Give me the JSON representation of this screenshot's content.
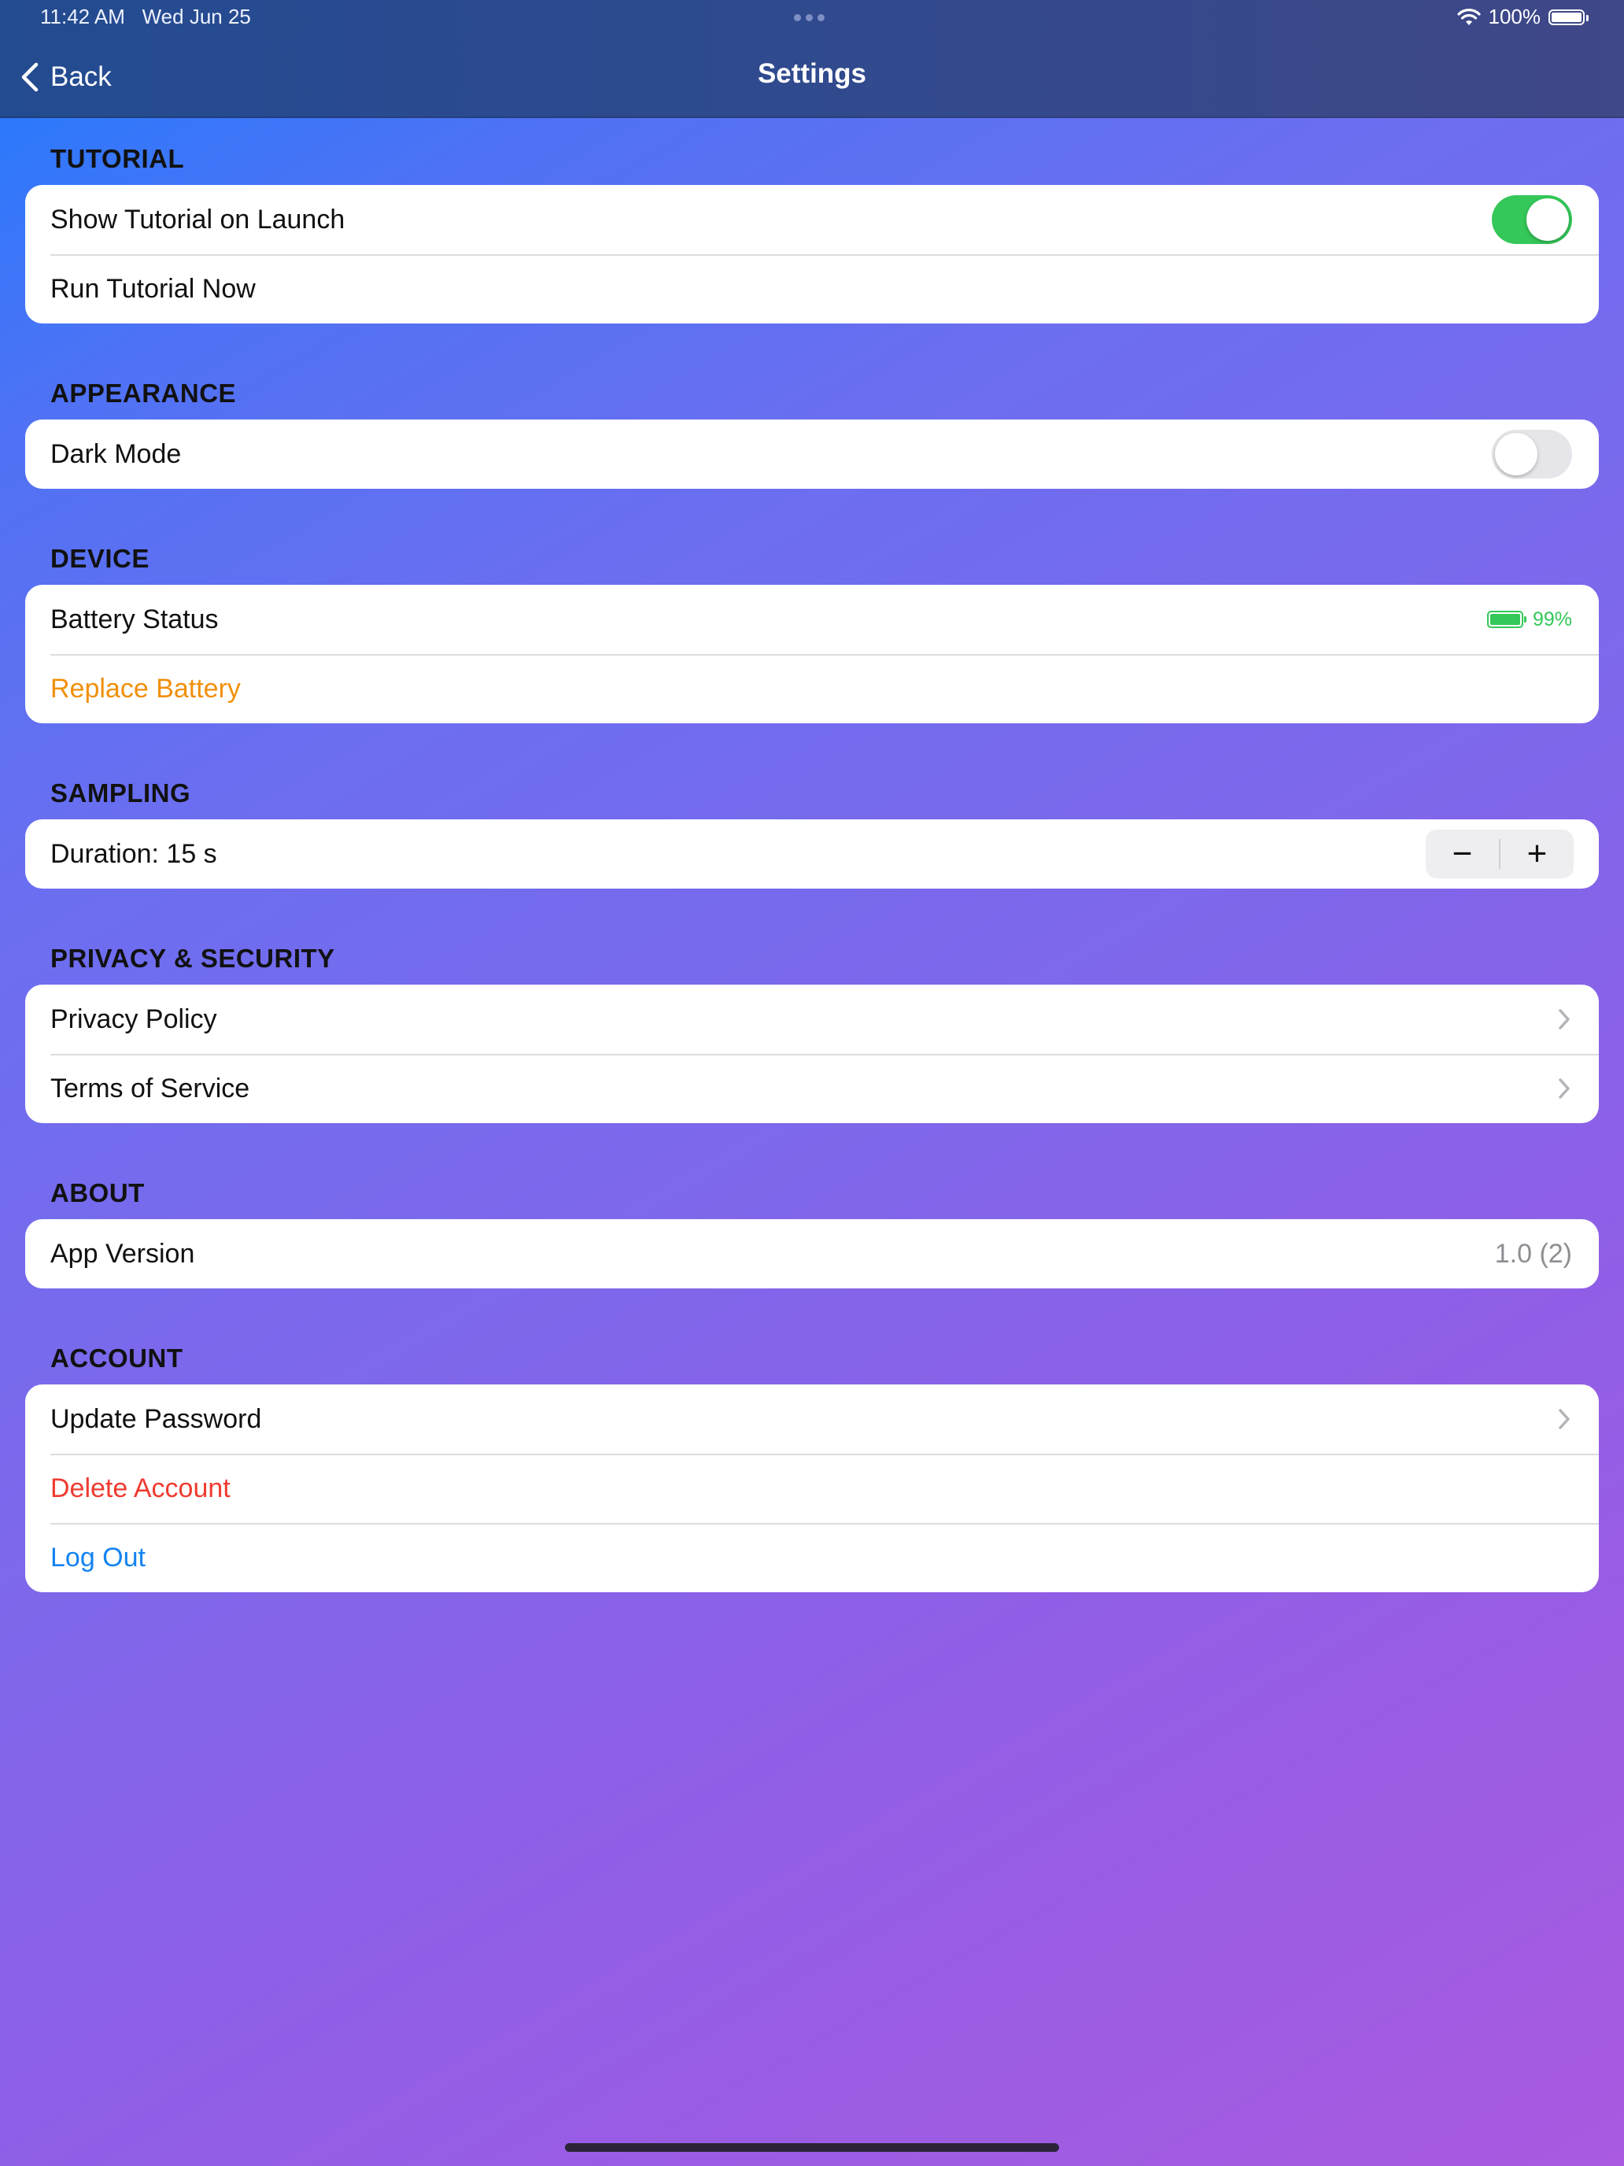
{
  "status_bar": {
    "time": "11:42 AM",
    "date": "Wed Jun 25",
    "battery_percent": "100%",
    "battery_level": 1.0,
    "icons": [
      "wifi-icon",
      "battery-icon"
    ]
  },
  "nav": {
    "back_label": "Back",
    "title": "Settings"
  },
  "sections": {
    "tutorial": {
      "header": "TUTORIAL",
      "show_on_launch_label": "Show Tutorial on Launch",
      "show_on_launch_enabled": true,
      "run_now_label": "Run Tutorial Now"
    },
    "appearance": {
      "header": "APPEARANCE",
      "dark_mode_label": "Dark Mode",
      "dark_mode_enabled": false
    },
    "device": {
      "header": "DEVICE",
      "battery_status_label": "Battery Status",
      "battery_value": "99%",
      "battery_level": 0.99,
      "replace_battery_label": "Replace Battery"
    },
    "sampling": {
      "header": "SAMPLING",
      "duration_label": "Duration: 15 s",
      "decrement_symbol": "−",
      "increment_symbol": "+"
    },
    "privacy": {
      "header": "PRIVACY & SECURITY",
      "privacy_policy_label": "Privacy Policy",
      "terms_label": "Terms of Service"
    },
    "about": {
      "header": "ABOUT",
      "app_version_label": "App Version",
      "app_version_value": "1.0 (2)"
    },
    "account": {
      "header": "ACCOUNT",
      "update_password_label": "Update Password",
      "delete_account_label": "Delete Account",
      "log_out_label": "Log Out"
    }
  },
  "colors": {
    "toggle_on": "#34c759",
    "warning": "#f0900c",
    "destructive": "#ef3b30",
    "link": "#1483f0",
    "battery_good": "#34c759"
  }
}
